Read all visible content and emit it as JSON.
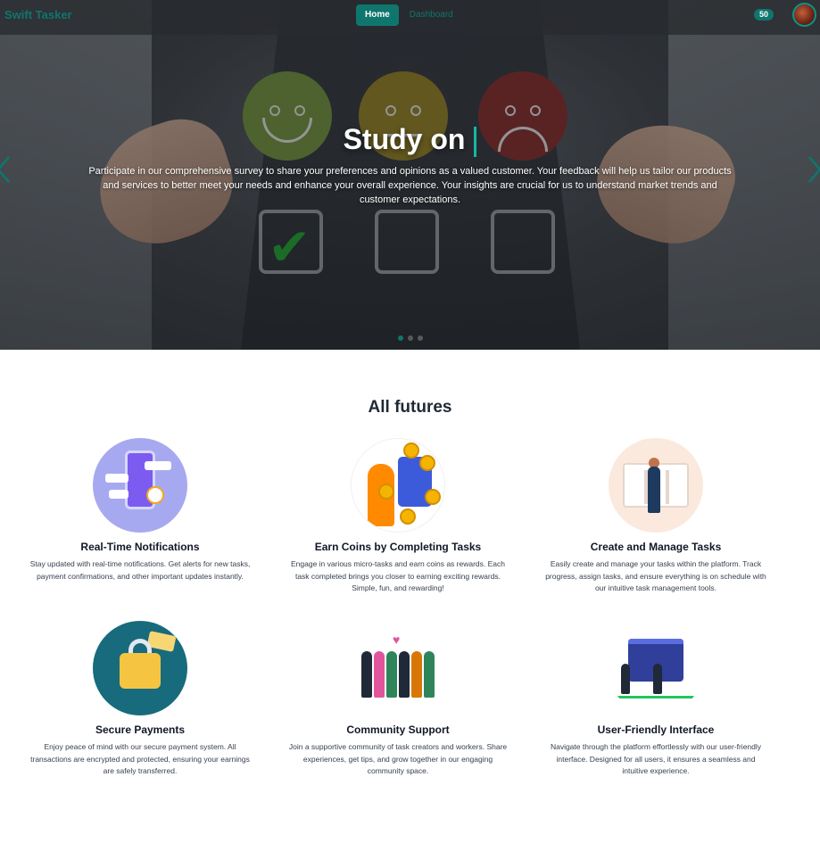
{
  "navbar": {
    "brand": "Swift Tasker",
    "links": [
      {
        "label": "Home",
        "active": true
      },
      {
        "label": "Dashboard",
        "active": false
      }
    ],
    "coins": "50",
    "accent_color": "#0f766e"
  },
  "hero": {
    "title": "Study on",
    "description": "Participate in our comprehensive survey to share your preferences and opinions as a valued customer. Your feedback will help us tailor our products and services to better meet your needs and enhance your overall experience. Your insights are crucial for us to understand market trends and customer expectations.",
    "prev_icon": "chevron-left-icon",
    "next_icon": "chevron-right-icon",
    "slide_count": 3,
    "active_slide": 1
  },
  "features": {
    "title": "All futures",
    "items": [
      {
        "title": "Real-Time Notifications",
        "text": "Stay updated with real-time notifications. Get alerts for new tasks, payment confirmations, and other important updates instantly.",
        "icon": "notification-illustration"
      },
      {
        "title": "Earn Coins by Completing Tasks",
        "text": "Engage in various micro-tasks and earn coins as rewards. Each task completed brings you closer to earning exciting rewards. Simple, fun, and rewarding!",
        "icon": "coins-illustration"
      },
      {
        "title": "Create and Manage Tasks",
        "text": "Easily create and manage your tasks within the platform. Track progress, assign tasks, and ensure everything is on schedule with our intuitive task management tools.",
        "icon": "task-board-illustration"
      },
      {
        "title": "Secure Payments",
        "text": "Enjoy peace of mind with our secure payment system. All transactions are encrypted and protected, ensuring your earnings are safely transferred.",
        "icon": "secure-payment-illustration"
      },
      {
        "title": "Community Support",
        "text": "Join a supportive community of task creators and workers. Share experiences, get tips, and grow together in our engaging community space.",
        "icon": "community-illustration"
      },
      {
        "title": "User-Friendly Interface",
        "text": "Navigate through the platform effortlessly with our user-friendly interface. Designed for all users, it ensures a seamless and intuitive experience.",
        "icon": "user-interface-illustration"
      }
    ]
  }
}
